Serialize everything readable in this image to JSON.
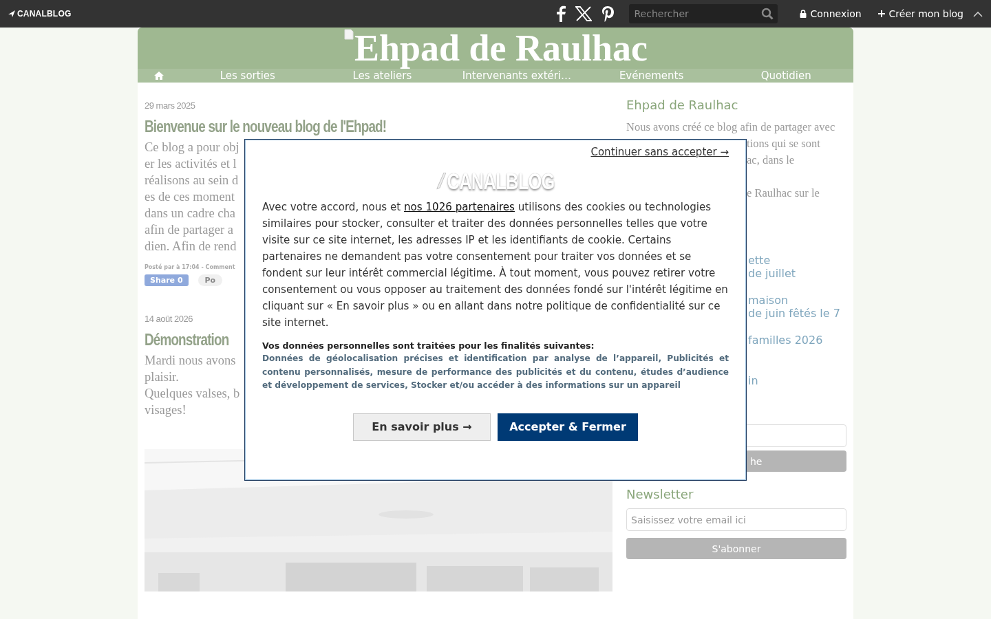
{
  "top_bar": {
    "logo": "CANALBLOG",
    "search": {
      "placeholder": "Rechercher"
    },
    "login": "Connexion",
    "create": "Créer mon blog"
  },
  "blog": {
    "title": "Ehpad de Raulhac",
    "nav": [
      "Les sorties",
      "Les ateliers",
      "Intervenants extéri…",
      "Evénements",
      "Quotidien"
    ]
  },
  "posts": [
    {
      "date": "29 mars 2025",
      "title": "Bienvenue sur le nouveau blog de l'Ehpad!",
      "lines": [
        "Ce blog a pour obj",
        "er les activités et l",
        "réalisons au sein d",
        "es de ces moment",
        "dans un cadre cha",
        "afin de partager a",
        "dien. Afin de rend"
      ],
      "meta": "Posté par à 17:04 - Comment",
      "share": [
        "Share 0",
        "Po"
      ]
    },
    {
      "date": "14 août 2026",
      "title": "Démonstration",
      "lines": [
        "Mardi nous avons",
        "plaisir.",
        "Quelques valses, b",
        "visages!"
      ],
      "photo": {
        "kind": "picture"
      }
    }
  ],
  "sidebar": {
    "title": "Ehpad de Raulhac",
    "intro": "Nous avons créé ce blog afin de partager avec",
    "intro_fragments": [
      "tions qui se sont",
      "ac, dans le"
    ],
    "intro_tail": "e Raulhac sur le",
    "links": [
      [
        "ette",
        "de juillet"
      ],
      [
        "maison",
        "de juin fêtés le 7"
      ],
      [
        "familles 2026"
      ],
      [
        "in"
      ]
    ],
    "search_button": "he",
    "newsletter": {
      "title": "Newsletter",
      "placeholder": "Saisissez votre email ici",
      "button": "S'abonner"
    }
  },
  "consent": {
    "skip": "Continuer sans accepter →",
    "logo": "CANALBLOG",
    "text_before": "Avec votre accord, nous et ",
    "partners_link": "nos 1026 partenaires",
    "text_after": " utilisons des cookies ou technologies similaires pour stocker, consulter et traiter des données personnelles telles que votre visite sur ce site internet, les adresses IP et les identifiants de cookie. Certains partenaires ne demandent pas votre consentement pour traiter vos données et se fondent sur leur intérêt commercial légitime. À tout moment, vous pouvez retirer votre consentement ou vous opposer au traitement des données fondé sur l'intérêt légitime en cliquant sur « En savoir plus » ou en allant dans notre politique de confidentialité sur ce site internet.",
    "purposes_title": "Vos données personnelles sont traitées pour les finalités suivantes:",
    "purposes": "Données de géolocalisation précises et identification par analyse de l’appareil, Publicités et contenu personnalisés, mesure de performance des publicités et du contenu, études d’audience et développement de services, Stocker et/ou accéder à des informations sur un appareil",
    "buttons": [
      {
        "label": "En savoir plus →",
        "kind": "secondary"
      },
      {
        "label": "Accepter & Fermer",
        "kind": "primary"
      }
    ]
  }
}
